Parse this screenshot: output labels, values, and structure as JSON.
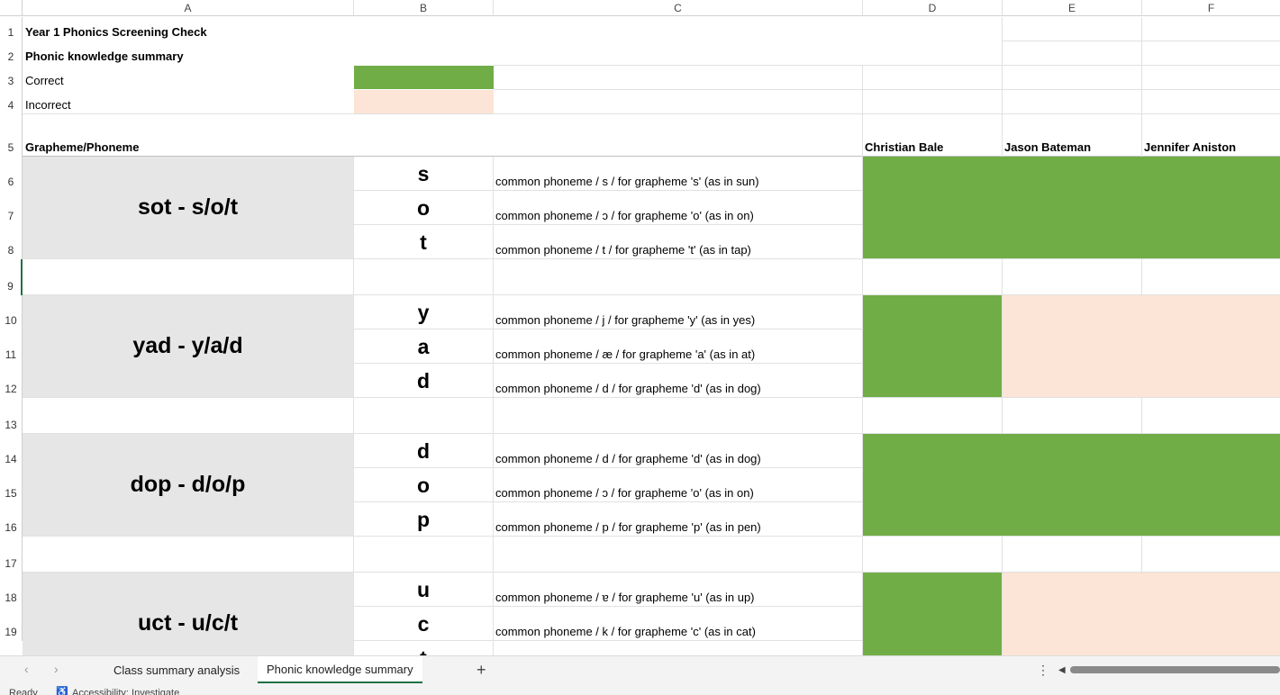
{
  "columns": [
    "A",
    "B",
    "C",
    "D",
    "E",
    "F"
  ],
  "rows": [
    "1",
    "2",
    "3",
    "4",
    "5",
    "6",
    "7",
    "8",
    "9",
    "10",
    "11",
    "12",
    "13",
    "14",
    "15",
    "16",
    "17",
    "18",
    "19"
  ],
  "header": {
    "title": "Year 1 Phonics Screening Check",
    "subtitle": "Phonic knowledge summary",
    "legend_correct": "Correct",
    "legend_incorrect": "Incorrect",
    "col_header": "Grapheme/Phoneme",
    "students": [
      "Christian Bale",
      "Jason Bateman",
      "Jennifer Aniston"
    ]
  },
  "words": [
    {
      "word": "sot - s/o/t",
      "letters": [
        "s",
        "o",
        "t"
      ],
      "descs": [
        "common phoneme / s / for grapheme 's' (as in sun)",
        "common phoneme / ɔ / for grapheme 'o' (as in on)",
        "common phoneme / t / for grapheme 't' (as in tap)"
      ]
    },
    {
      "word": "yad - y/a/d",
      "letters": [
        "y",
        "a",
        "d"
      ],
      "descs": [
        "common phoneme / j / for grapheme 'y' (as in yes)",
        "common phoneme / æ / for grapheme 'a' (as in at)",
        "common phoneme / d / for grapheme 'd' (as in dog)"
      ]
    },
    {
      "word": "dop - d/o/p",
      "letters": [
        "d",
        "o",
        "p"
      ],
      "descs": [
        "common phoneme / d / for grapheme 'd' (as in dog)",
        "common phoneme / ɔ / for grapheme 'o' (as in on)",
        "common phoneme / p / for grapheme 'p' (as in pen)"
      ]
    },
    {
      "word": "uct - u/c/t",
      "letters": [
        "u",
        "c",
        "t"
      ],
      "descs": [
        "common phoneme / ɐ / for grapheme 'u' (as in up)",
        "common phoneme / k / for grapheme 'c'  (as in cat)",
        ""
      ]
    }
  ],
  "sheet_tabs": [
    "Class summary analysis",
    "Phonic knowledge summary"
  ],
  "active_tab": "Phonic knowledge summary",
  "status": {
    "ready": "Ready",
    "accessibility": "Accessibility: Investigate"
  },
  "colors": {
    "correct": "#70ad47",
    "incorrect": "#fce4d6",
    "word_bg": "#e7e6e6",
    "accent": "#1e7145"
  }
}
